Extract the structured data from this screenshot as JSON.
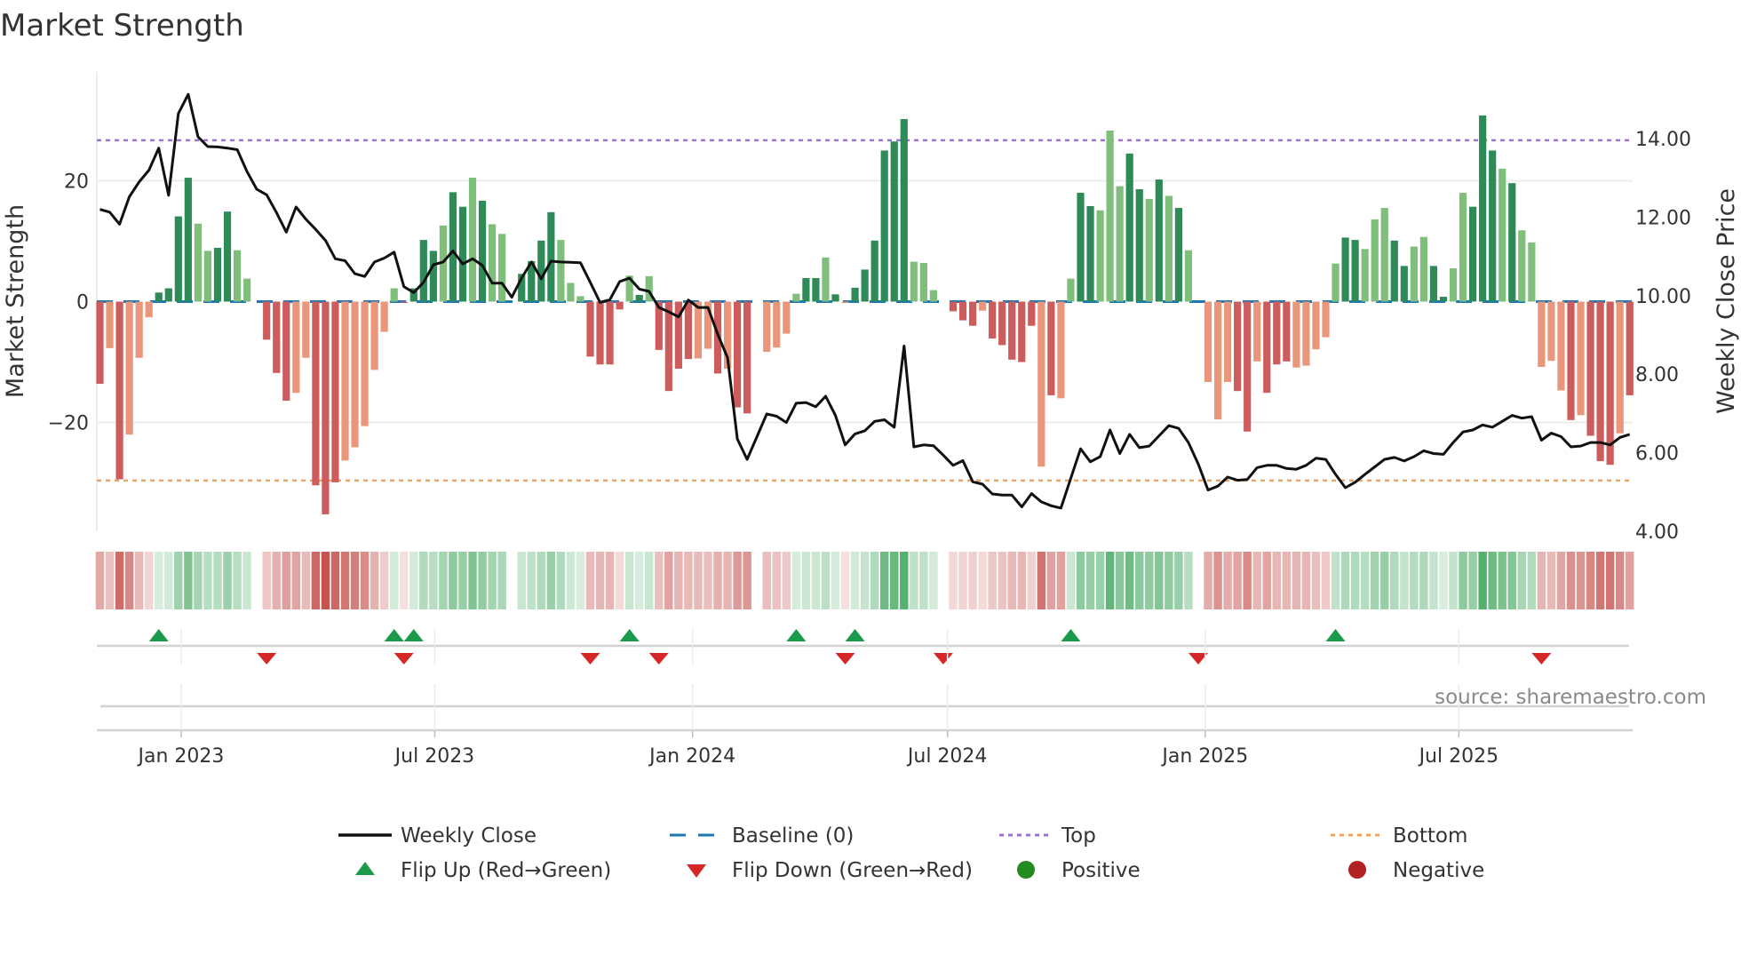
{
  "chart_data": {
    "type": "bar",
    "title": "Market Strength",
    "ylabel": "Market Strength",
    "y2label": "Weekly Close Price",
    "ylim": [
      -38,
      38
    ],
    "y2lim": [
      4.0,
      15.7
    ],
    "yticks": [
      {
        "value": 20,
        "label": "20"
      },
      {
        "value": 0,
        "label": "0"
      },
      {
        "value": -20,
        "label": "−20"
      }
    ],
    "y2ticks": [
      {
        "value": 14,
        "label": "14.00"
      },
      {
        "value": 12,
        "label": "12.00"
      },
      {
        "value": 10,
        "label": "10.00"
      },
      {
        "value": 8,
        "label": "8.00"
      },
      {
        "value": 6,
        "label": "6.00"
      },
      {
        "value": 4,
        "label": "4.00"
      }
    ],
    "start_week": "2022-11-04",
    "frequency": "weekly",
    "xticks": [
      {
        "date": "2023-01-01",
        "label": "Jan 2023"
      },
      {
        "date": "2023-07-01",
        "label": "Jul 2023"
      },
      {
        "date": "2024-01-01",
        "label": "Jan 2024"
      },
      {
        "date": "2024-07-01",
        "label": "Jul 2024"
      },
      {
        "date": "2025-01-01",
        "label": "Jan 2025"
      },
      {
        "date": "2025-07-01",
        "label": "Jul 2025"
      }
    ],
    "strength": [
      -13.6,
      -7.7,
      -29.4,
      -22,
      -9.3,
      -2.6,
      1.5,
      2.2,
      14.1,
      20.5,
      12.9,
      8.4,
      8.9,
      14.9,
      8.5,
      3.8,
      0,
      -6.3,
      -11.8,
      -16.4,
      -15.1,
      -9.3,
      -30.4,
      -35.2,
      -29.9,
      -26.3,
      -24.1,
      -20.6,
      -11.3,
      -5,
      2.2,
      -0.2,
      2.2,
      10.2,
      8.4,
      12.6,
      18.1,
      15.7,
      20.5,
      16.7,
      12.8,
      11.2,
      0,
      4.6,
      6.7,
      10.1,
      14.8,
      10.2,
      3.1,
      0.9,
      -9.1,
      -10.4,
      -10.4,
      -1.3,
      4.3,
      1.1,
      4.2,
      -8,
      -14.8,
      -11.1,
      -9.5,
      -9.4,
      -7.8,
      -11.9,
      -11.1,
      -17.5,
      -18.5,
      0,
      -8.3,
      -7.6,
      -5.3,
      1.3,
      3.9,
      3.9,
      7.3,
      1.2,
      -0.2,
      2.3,
      5.3,
      10.1,
      25,
      26.5,
      30.2,
      6.6,
      6.4,
      1.9,
      0,
      -1.6,
      -3.1,
      -4,
      -1.5,
      -6.1,
      -7.2,
      -9.6,
      -10,
      -4,
      -27.3,
      -15.5,
      -16,
      3.8,
      18,
      15.8,
      15.1,
      28.3,
      19.1,
      24.5,
      18.6,
      17,
      20.2,
      17.5,
      15.5,
      8.5,
      0,
      -13.3,
      -19.5,
      -13.3,
      -14.8,
      -21.5,
      -9.9,
      -15.1,
      -10.4,
      -9.9,
      -10.9,
      -10.6,
      -7.9,
      -5.9,
      6.3,
      10.6,
      10.2,
      8.7,
      13.6,
      15.5,
      10.1,
      5.9,
      9.1,
      10.7,
      5.9,
      0.8,
      5.5,
      18,
      15.7,
      30.8,
      25,
      22,
      19.6,
      11.8,
      9.8,
      -10.8,
      -9.8,
      -14.7,
      -19.6,
      -18.8,
      -22.2,
      -26.4,
      -27,
      -21.8,
      -15.5
    ],
    "strength_shade": "dldlllddddllddllldddlldddllllllddddlddldlllddddlllddddldlddddlldldddllllddldlddddddlllddddldddddldllddlllddldldlllllddldddlllllddlllddllddlldddldllllldldddldddll",
    "weekly_close": [
      12.2,
      12.13,
      11.82,
      12.52,
      12.9,
      13.2,
      13.76,
      12.56,
      14.64,
      15.13,
      14.05,
      13.8,
      13.79,
      13.76,
      13.72,
      13.16,
      12.71,
      12.57,
      12.12,
      11.62,
      12.26,
      11.95,
      11.69,
      11.41,
      10.94,
      10.89,
      10.56,
      10.49,
      10.86,
      10.96,
      11.11,
      10.23,
      10.08,
      10.34,
      10.79,
      10.86,
      11.14,
      10.81,
      10.94,
      10.77,
      10.32,
      10.32,
      9.96,
      10.45,
      10.86,
      10.43,
      10.88,
      10.86,
      10.85,
      10.84,
      10.34,
      9.83,
      9.9,
      10.36,
      10.45,
      10.17,
      10.11,
      9.7,
      9.59,
      9.46,
      9.89,
      9.7,
      9.7,
      9.02,
      8.42,
      6.35,
      5.83,
      6.41,
      6.99,
      6.93,
      6.77,
      7.26,
      7.28,
      7.17,
      7.44,
      6.95,
      6.2,
      6.48,
      6.56,
      6.8,
      6.84,
      6.65,
      8.72,
      6.15,
      6.2,
      6.18,
      5.94,
      5.68,
      5.8,
      5.26,
      5.2,
      4.95,
      4.92,
      4.92,
      4.62,
      4.96,
      4.75,
      4.65,
      4.59,
      5.35,
      6.1,
      5.77,
      5.9,
      6.58,
      5.98,
      6.47,
      6.13,
      6.17,
      6.43,
      6.69,
      6.62,
      6.26,
      5.71,
      5.05,
      5.15,
      5.38,
      5.3,
      5.32,
      5.62,
      5.68,
      5.68,
      5.6,
      5.58,
      5.68,
      5.86,
      5.83,
      5.45,
      5.11,
      5.25,
      5.45,
      5.64,
      5.83,
      5.88,
      5.79,
      5.9,
      6.05,
      5.98,
      5.96,
      6.26,
      6.53,
      6.58,
      6.71,
      6.65,
      6.8,
      6.95,
      6.88,
      6.92,
      6.32,
      6.5,
      6.41,
      6.15,
      6.17,
      6.26,
      6.26,
      6.2,
      6.39,
      6.47
    ],
    "top_level": 26.7,
    "bottom_level": -29.6,
    "baseline": 0,
    "flip_up_weeks": [
      6,
      30,
      32,
      54,
      71,
      77,
      99,
      126
    ],
    "flip_down_weeks": [
      17,
      31,
      50,
      57,
      76,
      86,
      112,
      147
    ],
    "legend": [
      {
        "label": "Weekly Close",
        "kind": "line"
      },
      {
        "label": "Baseline (0)",
        "kind": "dash"
      },
      {
        "label": "Top",
        "kind": "dot-purple"
      },
      {
        "label": "Bottom",
        "kind": "dot-orange"
      },
      {
        "label": "Flip Up (Red→Green)",
        "kind": "tri-up"
      },
      {
        "label": "Flip Down (Green→Red)",
        "kind": "tri-down"
      },
      {
        "label": "Positive",
        "kind": "dot-green"
      },
      {
        "label": "Negative",
        "kind": "dot-red"
      }
    ],
    "legend_placement": "bottom",
    "colors": {
      "pos_strong": "#2e8b57",
      "pos_weak": "#7fbf7b",
      "neg_strong": "#cd5c5c",
      "neg_weak": "#e9967a",
      "line": "#111111",
      "baseline": "#1f77b4",
      "top": "#a06ee0",
      "bottom": "#f0a35e",
      "flip_up": "#1a9a4a",
      "flip_down": "#d62728",
      "positive": "#228b22",
      "negative": "#b22222",
      "strip_pos": "#3da55a",
      "strip_neg": "#c5504c"
    }
  },
  "source": "source: sharemaestro.com"
}
